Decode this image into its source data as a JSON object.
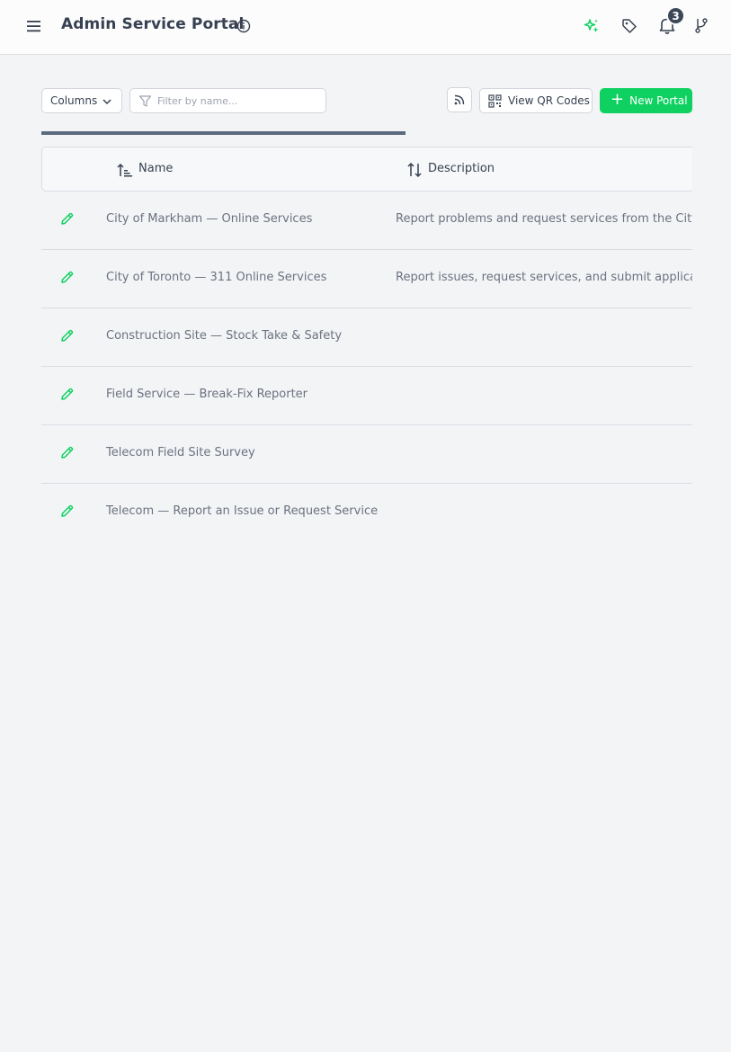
{
  "header": {
    "title": "Admin Service Portal",
    "notifications_count": "3",
    "icons": [
      "menu-icon",
      "info-icon",
      "sparkle-icon",
      "tag-icon",
      "bell-icon",
      "git-branch-icon"
    ],
    "accent_color": "#0fd162"
  },
  "toolbar": {
    "columns_label": "Columns",
    "filter_placeholder": "Filter by name...",
    "filter_value": "",
    "qr_label": "View QR Codes",
    "new_portal_label": "New Portal"
  },
  "progress": {
    "fraction": 0.56
  },
  "table": {
    "columns": [
      "Name",
      "Description"
    ],
    "rows": [
      {
        "name": "City of Markham — Online Services",
        "description": "Report problems and request services from the City of Markham"
      },
      {
        "name": "City of Toronto — 311 Online Services",
        "description": "Report issues, request services, and submit applications"
      },
      {
        "name": "Construction Site — Stock Take & Safety",
        "description": ""
      },
      {
        "name": "Field Service — Break-Fix Reporter",
        "description": ""
      },
      {
        "name": "Telecom Field Site Survey",
        "description": ""
      },
      {
        "name": "Telecom — Report an Issue or Request Service",
        "description": ""
      }
    ]
  }
}
